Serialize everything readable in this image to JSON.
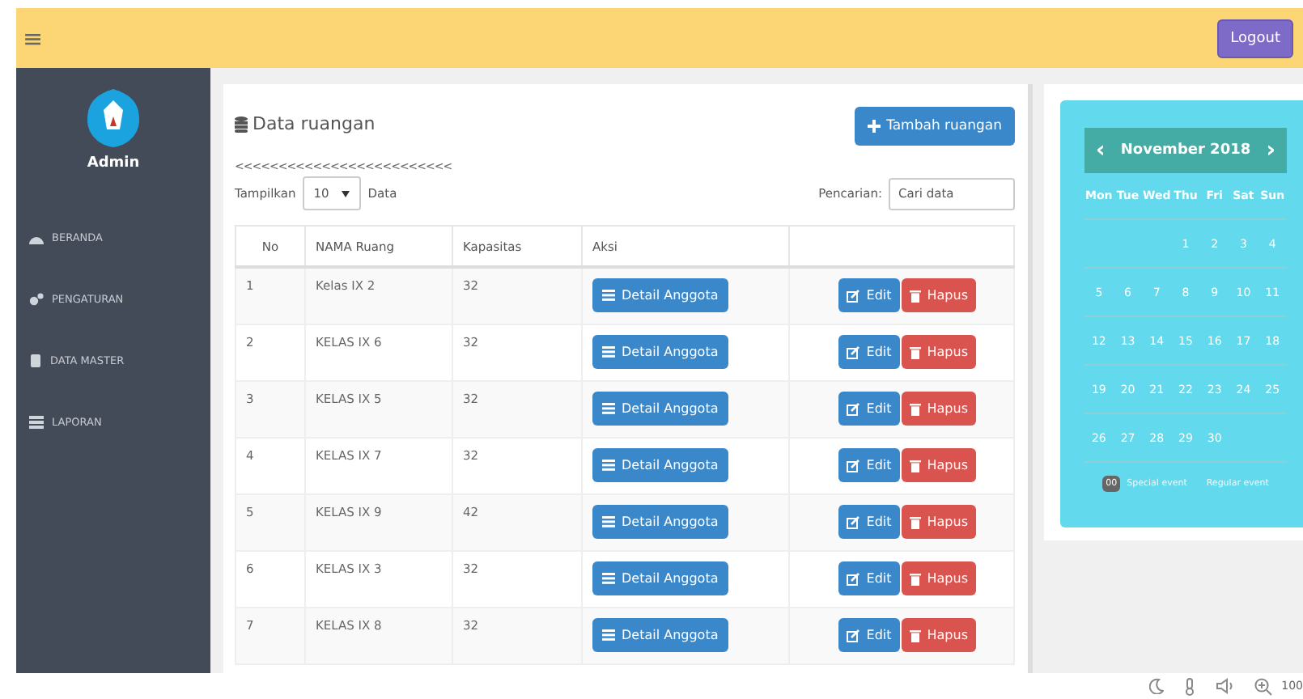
{
  "header": {
    "menu_glyph": "≡",
    "logout": "Logout"
  },
  "sidebar": {
    "user": "Admin",
    "items": [
      {
        "label": "BERANDA"
      },
      {
        "label": "PENGATURAN"
      },
      {
        "label": "DATA MASTER"
      },
      {
        "label": "LAPORAN"
      }
    ]
  },
  "panel": {
    "title": "Data ruangan",
    "add_button": "Tambah ruangan",
    "pager_marks": "<<<<<<<<<<<<<<<<<<<<<<<<<",
    "show_label": "Tampilkan",
    "page_size": "10",
    "show_suffix": "Data",
    "search_label": "Pencarian:",
    "search_placeholder": "Cari data"
  },
  "table": {
    "columns": [
      "No",
      "NAMA Ruang",
      "Kapasitas",
      "Aksi"
    ],
    "rows": [
      {
        "no": "1",
        "name": "Kelas IX 2",
        "capacity": "32",
        "detail": "Detail Anggota",
        "edit": "Edit",
        "delete": "Hapus"
      },
      {
        "no": "2",
        "name": "KELAS IX 6",
        "capacity": "32",
        "detail": "Detail Anggota",
        "edit": "Edit",
        "delete": "Hapus"
      },
      {
        "no": "3",
        "name": "KELAS IX 5",
        "capacity": "32",
        "detail": "Detail Anggota",
        "edit": "Edit",
        "delete": "Hapus"
      },
      {
        "no": "4",
        "name": "KELAS IX 7",
        "capacity": "32",
        "detail": "Detail Anggota",
        "edit": "Edit",
        "delete": "Hapus"
      },
      {
        "no": "5",
        "name": "KELAS IX 9",
        "capacity": "42",
        "detail": "Detail Anggota",
        "edit": "Edit",
        "delete": "Hapus"
      },
      {
        "no": "6",
        "name": "KELAS IX 3",
        "capacity": "32",
        "detail": "Detail Anggota",
        "edit": "Edit",
        "delete": "Hapus"
      },
      {
        "no": "7",
        "name": "KELAS IX 8",
        "capacity": "32",
        "detail": "Detail Anggota",
        "edit": "Edit",
        "delete": "Hapus"
      }
    ]
  },
  "calendar": {
    "prev": "‹",
    "month": "November 2018",
    "next": "›",
    "weekdays": [
      "Mon",
      "Tue",
      "Wed",
      "Thu",
      "Fri",
      "Sat",
      "Sun"
    ],
    "weeks": [
      [
        "1",
        "2",
        "3",
        "4"
      ],
      [
        "5",
        "6",
        "7",
        "8",
        "9",
        "10",
        "11"
      ],
      [
        "12",
        "13",
        "14",
        "15",
        "16",
        "17",
        "18"
      ],
      [
        "19",
        "20",
        "21",
        "22",
        "23",
        "24",
        "25"
      ],
      [
        "26",
        "27",
        "28",
        "29",
        "30"
      ]
    ],
    "legend": {
      "badge": "00",
      "special": "Special event",
      "regular": "Regular event"
    }
  },
  "status_bar": {
    "zoom": "100"
  }
}
